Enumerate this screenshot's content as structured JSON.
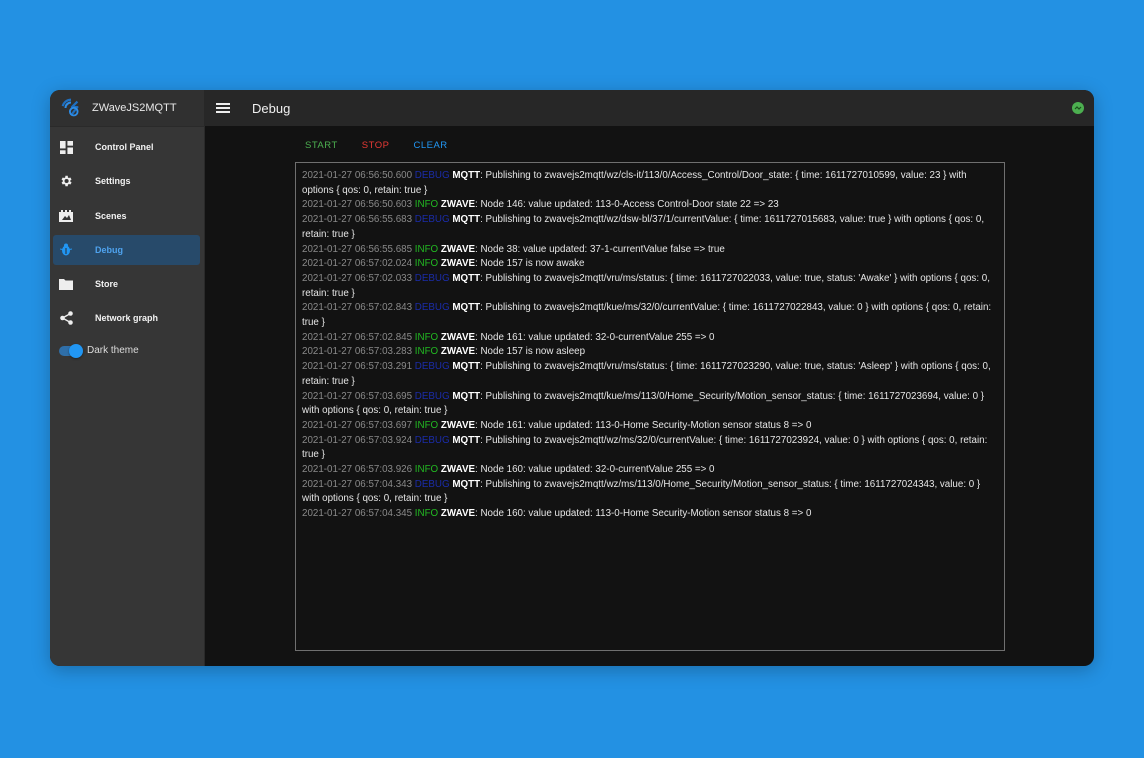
{
  "app": {
    "name": "ZWaveJS2MQTT"
  },
  "sidebar": {
    "items": [
      {
        "label": "Control Panel",
        "icon": "dashboard-icon"
      },
      {
        "label": "Settings",
        "icon": "gear-icon"
      },
      {
        "label": "Scenes",
        "icon": "scenes-icon"
      },
      {
        "label": "Debug",
        "icon": "bug-icon",
        "active": true
      },
      {
        "label": "Store",
        "icon": "folder-icon"
      },
      {
        "label": "Network graph",
        "icon": "share-icon"
      }
    ],
    "dark_theme_label": "Dark theme",
    "dark_theme_on": true
  },
  "header": {
    "title": "Debug",
    "status_color": "#4caf50"
  },
  "toolbar": {
    "start": "START",
    "stop": "STOP",
    "clear": "CLEAR"
  },
  "colors": {
    "accent": "#2196f3",
    "info": "#22b822",
    "debug": "#1b2ca8",
    "stop": "#e53935"
  },
  "log": [
    {
      "ts": "2021-01-27 06:56:50.600",
      "level": "DEBUG",
      "module": "MQTT",
      "msg": ": Publishing to zwavejs2mqtt/wz/cls-it/113/0/Access_Control/Door_state: { time: 1611727010599, value: 23 } with options { qos: 0, retain: true }"
    },
    {
      "ts": "2021-01-27 06:56:50.603",
      "level": "INFO",
      "module": "ZWAVE",
      "msg": ": Node 146: value updated: 113-0-Access Control-Door state 22 => 23"
    },
    {
      "ts": "2021-01-27 06:56:55.683",
      "level": "DEBUG",
      "module": "MQTT",
      "msg": ": Publishing to zwavejs2mqtt/wz/dsw-bl/37/1/currentValue: { time: 1611727015683, value: true } with options { qos: 0, retain: true }"
    },
    {
      "ts": "2021-01-27 06:56:55.685",
      "level": "INFO",
      "module": "ZWAVE",
      "msg": ": Node 38: value updated: 37-1-currentValue false => true"
    },
    {
      "ts": "2021-01-27 06:57:02.024",
      "level": "INFO",
      "module": "ZWAVE",
      "msg": ": Node 157 is now awake"
    },
    {
      "ts": "2021-01-27 06:57:02.033",
      "level": "DEBUG",
      "module": "MQTT",
      "msg": ": Publishing to zwavejs2mqtt/vru/ms/status: { time: 1611727022033, value: true, status: 'Awake' } with options { qos: 0, retain: true }"
    },
    {
      "ts": "2021-01-27 06:57:02.843",
      "level": "DEBUG",
      "module": "MQTT",
      "msg": ": Publishing to zwavejs2mqtt/kue/ms/32/0/currentValue: { time: 1611727022843, value: 0 } with options { qos: 0, retain: true }"
    },
    {
      "ts": "2021-01-27 06:57:02.845",
      "level": "INFO",
      "module": "ZWAVE",
      "msg": ": Node 161: value updated: 32-0-currentValue 255 => 0"
    },
    {
      "ts": "2021-01-27 06:57:03.283",
      "level": "INFO",
      "module": "ZWAVE",
      "msg": ": Node 157 is now asleep"
    },
    {
      "ts": "2021-01-27 06:57:03.291",
      "level": "DEBUG",
      "module": "MQTT",
      "msg": ": Publishing to zwavejs2mqtt/vru/ms/status: { time: 1611727023290, value: true, status: 'Asleep' } with options { qos: 0, retain: true }"
    },
    {
      "ts": "2021-01-27 06:57:03.695",
      "level": "DEBUG",
      "module": "MQTT",
      "msg": ": Publishing to zwavejs2mqtt/kue/ms/113/0/Home_Security/Motion_sensor_status: { time: 1611727023694, value: 0 } with options { qos: 0, retain: true }"
    },
    {
      "ts": "2021-01-27 06:57:03.697",
      "level": "INFO",
      "module": "ZWAVE",
      "msg": ": Node 161: value updated: 113-0-Home Security-Motion sensor status 8 => 0"
    },
    {
      "ts": "2021-01-27 06:57:03.924",
      "level": "DEBUG",
      "module": "MQTT",
      "msg": ": Publishing to zwavejs2mqtt/wz/ms/32/0/currentValue: { time: 1611727023924, value: 0 } with options { qos: 0, retain: true }"
    },
    {
      "ts": "2021-01-27 06:57:03.926",
      "level": "INFO",
      "module": "ZWAVE",
      "msg": ": Node 160: value updated: 32-0-currentValue 255 => 0"
    },
    {
      "ts": "2021-01-27 06:57:04.343",
      "level": "DEBUG",
      "module": "MQTT",
      "msg": ": Publishing to zwavejs2mqtt/wz/ms/113/0/Home_Security/Motion_sensor_status: { time: 1611727024343, value: 0 } with options { qos: 0, retain: true }"
    },
    {
      "ts": "2021-01-27 06:57:04.345",
      "level": "INFO",
      "module": "ZWAVE",
      "msg": ": Node 160: value updated: 113-0-Home Security-Motion sensor status 8 => 0"
    }
  ]
}
